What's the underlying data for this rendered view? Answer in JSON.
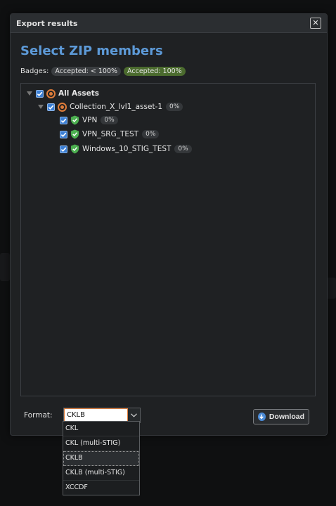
{
  "dialog": {
    "title": "Export results",
    "close_label": "✕",
    "heading": "Select ZIP members"
  },
  "badges": {
    "label": "Badges:",
    "items": [
      {
        "text": "Accepted: < 100%",
        "color": "#3a3d40"
      },
      {
        "text": "Accepted: 100%",
        "color": "#4b6b2e"
      }
    ]
  },
  "tree": {
    "root": {
      "label": "All Assets",
      "checked": true,
      "icon": "target-icon"
    },
    "collection": {
      "label": "Collection_X_lvl1_asset-1",
      "percent": "0%",
      "checked": true,
      "icon": "target-icon"
    },
    "stigs": [
      {
        "label": "VPN",
        "percent": "0%",
        "checked": true,
        "icon": "shield-check-icon"
      },
      {
        "label": "VPN_SRG_TEST",
        "percent": "0%",
        "checked": true,
        "icon": "shield-check-icon"
      },
      {
        "label": "Windows_10_STIG_TEST",
        "percent": "0%",
        "checked": true,
        "icon": "shield-check-icon"
      }
    ]
  },
  "format": {
    "label": "Format:",
    "value": "CKLB",
    "options": [
      "CKL",
      "CKL (multi-STIG)",
      "CKLB",
      "CKLB (multi-STIG)",
      "XCCDF"
    ]
  },
  "download_label": "Download",
  "colors": {
    "accent": "#5d9ad8",
    "checkbox": "#3c7fd4",
    "target": "#e07d3a",
    "shield": "#4caf50"
  }
}
